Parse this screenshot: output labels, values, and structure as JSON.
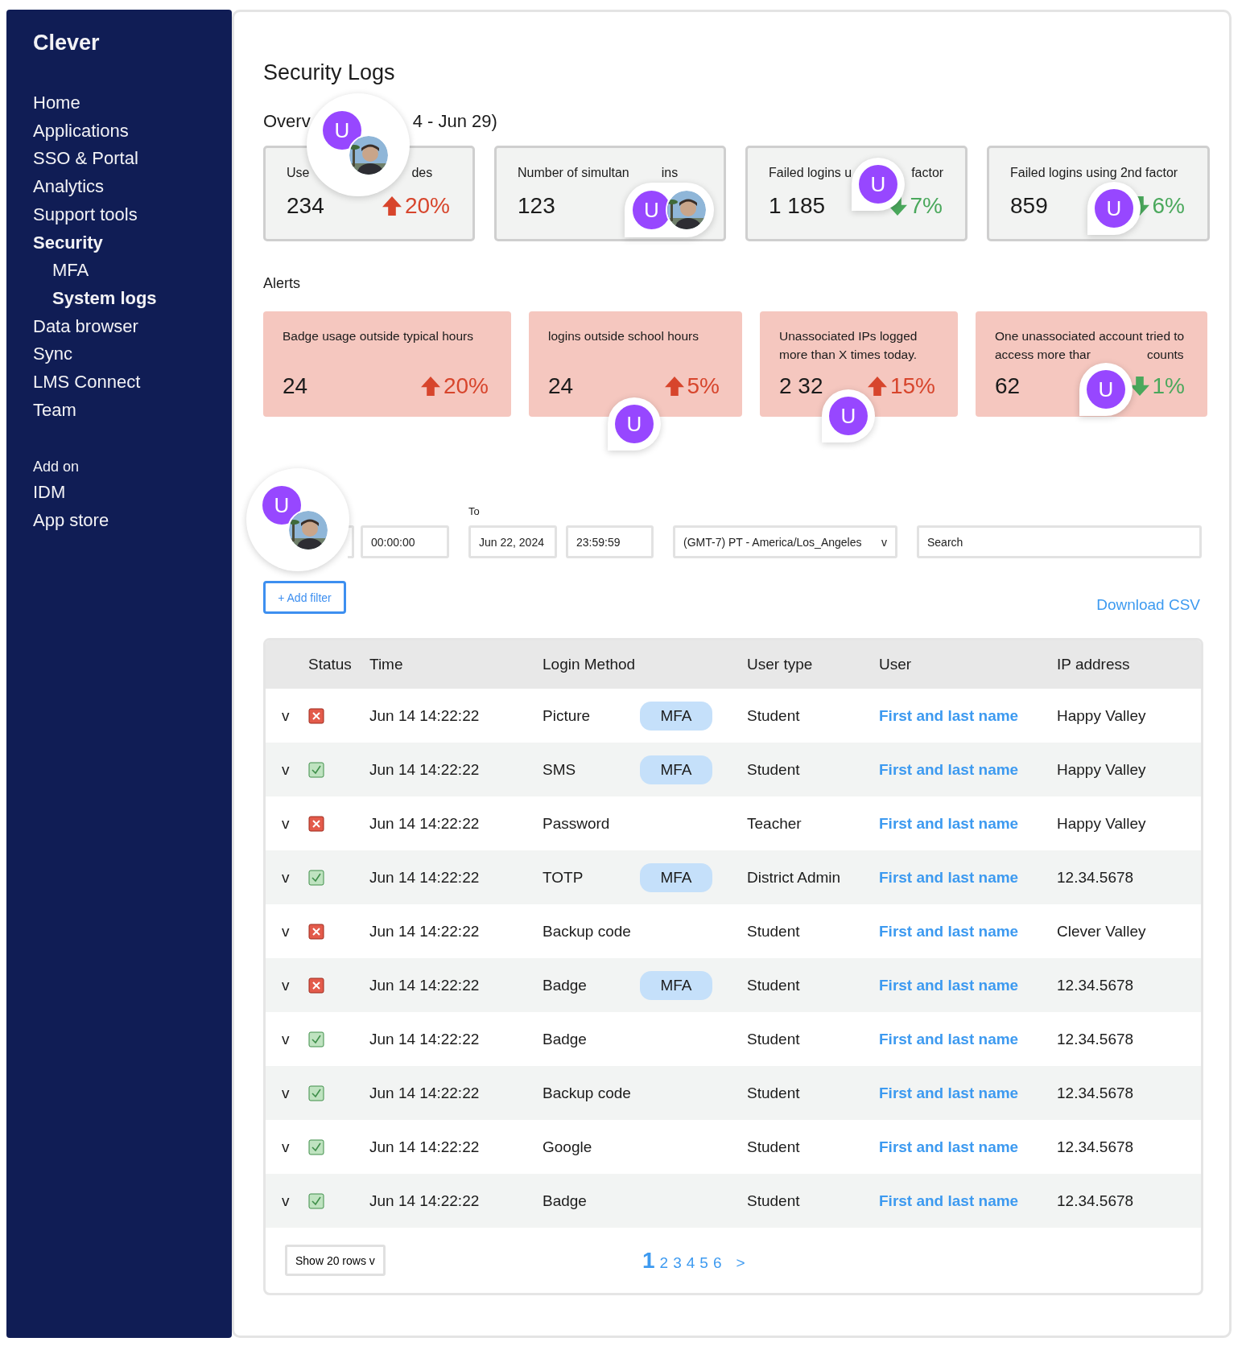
{
  "sidebar": {
    "brand": "Clever",
    "items": [
      {
        "label": "Home",
        "selected": false
      },
      {
        "label": "Applications",
        "selected": false
      },
      {
        "label": "SSO & Portal",
        "selected": false
      },
      {
        "label": "Analytics",
        "selected": false
      },
      {
        "label": "Support tools",
        "selected": false
      },
      {
        "label": "Security",
        "selected": true,
        "children": [
          {
            "label": "MFA",
            "selected": false
          },
          {
            "label": "System logs",
            "selected": true
          }
        ]
      },
      {
        "label": "Data browser",
        "selected": false
      },
      {
        "label": "Sync",
        "selected": false
      },
      {
        "label": "LMS Connect",
        "selected": false
      },
      {
        "label": "Team",
        "selected": false
      }
    ],
    "addon": {
      "heading": "Add on",
      "items": [
        {
          "label": "IDM",
          "selected": false
        },
        {
          "label": "App store",
          "selected": false
        }
      ]
    }
  },
  "page_title": "Security Logs",
  "overview": {
    "title_parts": [
      "Overv",
      "4 - Jun 29)"
    ],
    "cards": [
      {
        "label_parts": [
          "Use",
          "des"
        ],
        "value": "234",
        "change": {
          "up": true,
          "text": "20%"
        }
      },
      {
        "label_parts": [
          "Number of simultan",
          "ins"
        ],
        "value": "123"
      },
      {
        "label_parts": [
          "Failed logins u",
          "factor"
        ],
        "value": "1 185",
        "change": {
          "up": false,
          "text": "7%"
        }
      },
      {
        "label_parts": [
          "Failed logins using 2nd factor"
        ],
        "value": "859",
        "change": {
          "up": false,
          "text": "6%"
        }
      }
    ]
  },
  "alerts": {
    "title": "Alerts",
    "cards": [
      {
        "label_lines": [
          [
            "Badge usage outside typical hours"
          ]
        ],
        "value": "24",
        "change": {
          "up": true,
          "text": "20%"
        }
      },
      {
        "label_lines": [
          [
            "logins outside school hours"
          ]
        ],
        "value": "24",
        "change": {
          "up": true,
          "text": "5%"
        }
      },
      {
        "label_lines": [
          [
            "Unassociated IPs logged"
          ],
          [
            "more than X times today."
          ]
        ],
        "value": "2 32",
        "change": {
          "up": true,
          "text": "15%"
        }
      },
      {
        "label_lines": [
          [
            "One unassociated account tried to"
          ],
          [
            "access more thar",
            "counts"
          ]
        ],
        "value": "62",
        "change": {
          "up": false,
          "text": "1%"
        }
      }
    ]
  },
  "filters": {
    "fields": [
      {
        "kind": "sliver"
      },
      {
        "kind": "input",
        "value": "00:00:00"
      },
      {
        "kind": "input",
        "label": "To",
        "value": "Jun 22, 2024"
      },
      {
        "kind": "input",
        "value": "23:59:59"
      },
      {
        "kind": "select",
        "value": "(GMT-7) PT - America/Los_Angeles",
        "caret": "v"
      },
      {
        "kind": "search",
        "placeholder": "Search"
      }
    ],
    "add_filter": "+ Add filter",
    "download": "Download CSV"
  },
  "table": {
    "columns": [
      "Status",
      "Time",
      "Login Method",
      "User type",
      "User",
      "IP address"
    ],
    "rows": [
      {
        "expander": "v",
        "success": false,
        "time": "Jun 14 14:22:22",
        "method": "Picture",
        "badge": "MFA",
        "user_type": "Student",
        "user": "First and last name",
        "ip": "Happy Valley"
      },
      {
        "expander": "v",
        "success": true,
        "time": "Jun 14 14:22:22",
        "method": "SMS",
        "badge": "MFA",
        "user_type": "Student",
        "user": "First and last name",
        "ip": "Happy Valley"
      },
      {
        "expander": "v",
        "success": false,
        "time": "Jun 14 14:22:22",
        "method": "Password",
        "user_type": "Teacher",
        "user": "First and last name",
        "ip": "Happy Valley"
      },
      {
        "expander": "v",
        "success": true,
        "time": "Jun 14 14:22:22",
        "method": "TOTP",
        "badge": "MFA",
        "user_type": "District Admin",
        "user": "First and last name",
        "ip": "12.34.5678"
      },
      {
        "expander": "v",
        "success": false,
        "time": "Jun 14 14:22:22",
        "method": "Backup code",
        "user_type": "Student",
        "user": "First and last name",
        "ip": "Clever Valley"
      },
      {
        "expander": "v",
        "success": false,
        "time": "Jun 14 14:22:22",
        "method": "Badge",
        "badge": "MFA",
        "user_type": "Student",
        "user": "First and last name",
        "ip": "12.34.5678"
      },
      {
        "expander": "v",
        "success": true,
        "time": "Jun 14 14:22:22",
        "method": "Badge",
        "user_type": "Student",
        "user": "First and last name",
        "ip": "12.34.5678"
      },
      {
        "expander": "v",
        "success": true,
        "time": "Jun 14 14:22:22",
        "method": "Backup code",
        "user_type": "Student",
        "user": "First and last name",
        "ip": "12.34.5678"
      },
      {
        "expander": "v",
        "success": true,
        "time": "Jun 14 14:22:22",
        "method": "Google",
        "user_type": "Student",
        "user": "First and last name",
        "ip": "12.34.5678"
      },
      {
        "expander": "v",
        "success": true,
        "time": "Jun 14 14:22:22",
        "method": "Badge",
        "user_type": "Student",
        "user": "First and last name",
        "ip": "12.34.5678"
      }
    ],
    "rows_select": "Show 20 rows v",
    "pages": [
      {
        "label": "1",
        "selected": true
      },
      {
        "label": "2",
        "selected": false
      },
      {
        "label": "3",
        "selected": false
      },
      {
        "label": "4",
        "selected": false
      },
      {
        "label": "5",
        "selected": false
      },
      {
        "label": "6",
        "selected": false
      }
    ],
    "next": ">"
  },
  "pins": [
    {
      "kind": "pair",
      "initial": "U"
    },
    {
      "kind": "pair",
      "initial": "U"
    },
    {
      "kind": "single",
      "initial": "U"
    },
    {
      "kind": "single",
      "initial": "U"
    },
    {
      "kind": "single",
      "initial": "U"
    },
    {
      "kind": "single",
      "initial": "U"
    },
    {
      "kind": "single",
      "initial": "U"
    },
    {
      "kind": "pair",
      "initial": "U"
    }
  ]
}
